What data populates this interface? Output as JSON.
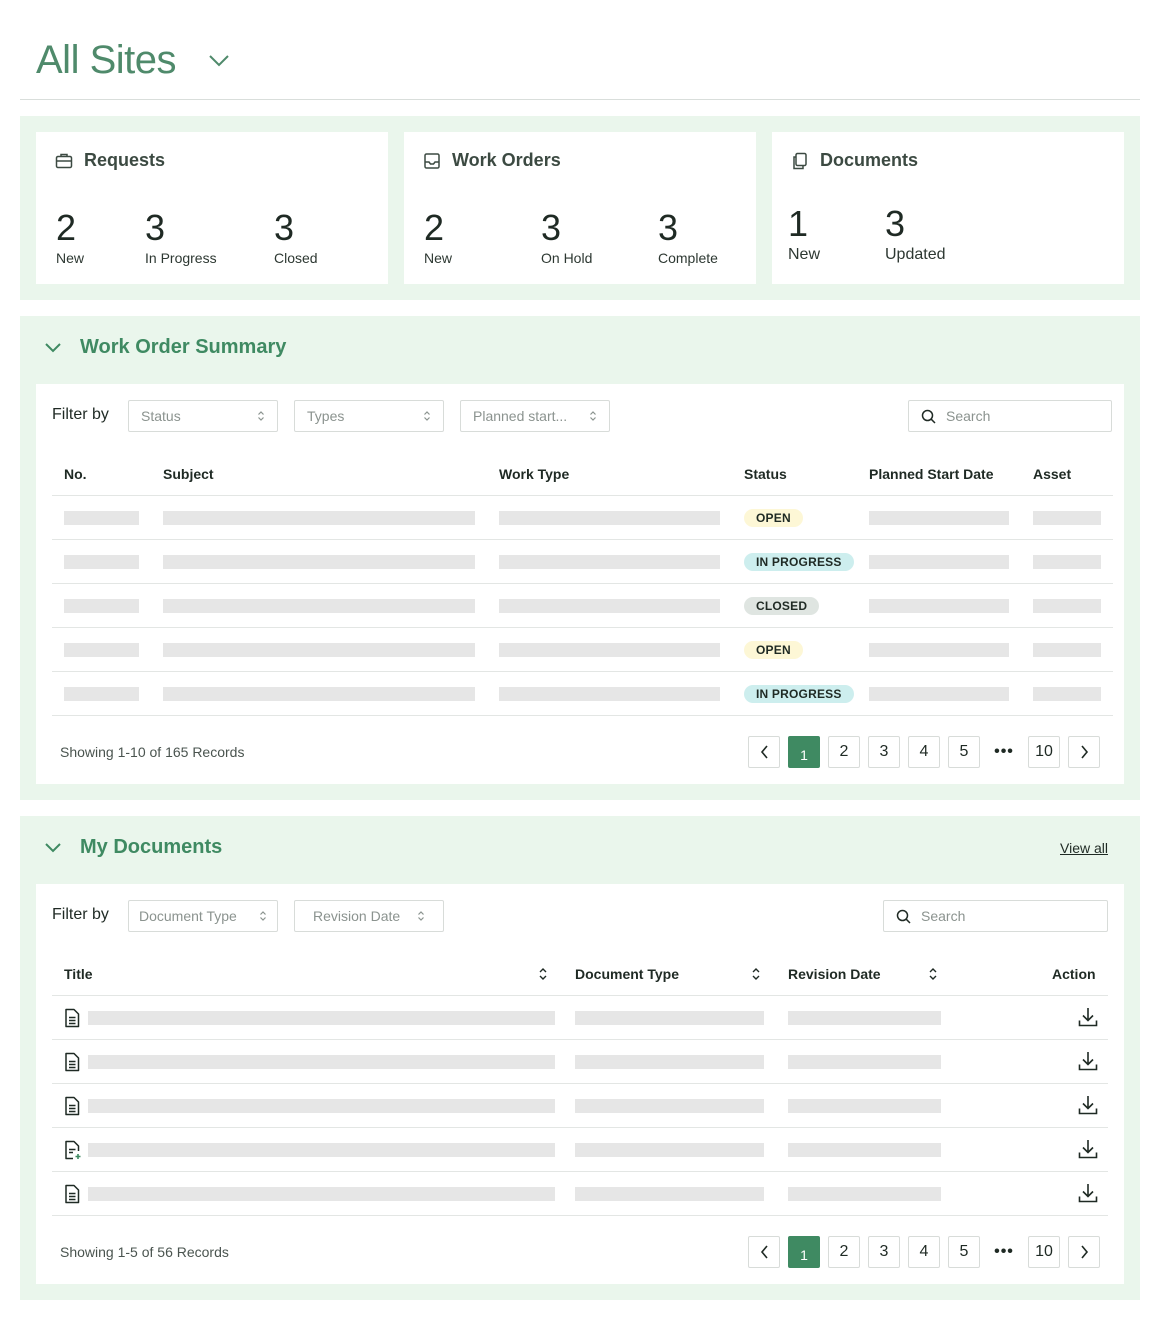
{
  "header": {
    "title": "All Sites"
  },
  "stats": {
    "requests": {
      "title": "Requests",
      "items": [
        {
          "value": "2",
          "label": "New"
        },
        {
          "value": "3",
          "label": "In Progress"
        },
        {
          "value": "3",
          "label": "Closed"
        }
      ]
    },
    "work_orders": {
      "title": "Work Orders",
      "items": [
        {
          "value": "2",
          "label": "New"
        },
        {
          "value": "3",
          "label": "On Hold"
        },
        {
          "value": "3",
          "label": "Complete"
        }
      ]
    },
    "documents": {
      "title": "Documents",
      "items": [
        {
          "value": "1",
          "label": "New"
        },
        {
          "value": "3",
          "label": "Updated"
        }
      ]
    }
  },
  "work_order_summary": {
    "title": "Work Order Summary",
    "filter_label": "Filter by",
    "filters": [
      "Status",
      "Types",
      "Planned start..."
    ],
    "search_placeholder": "Search",
    "columns": [
      "No.",
      "Subject",
      "Work Type",
      "Status",
      "Planned Start Date",
      "Asset"
    ],
    "rows": [
      {
        "status": "OPEN",
        "status_kind": "open"
      },
      {
        "status": "IN PROGRESS",
        "status_kind": "progress"
      },
      {
        "status": "CLOSED",
        "status_kind": "closed"
      },
      {
        "status": "OPEN",
        "status_kind": "open"
      },
      {
        "status": "IN PROGRESS",
        "status_kind": "progress"
      }
    ],
    "records_text": "Showing 1-10 of 165 Records",
    "pagination": {
      "pages": [
        "1",
        "2",
        "3",
        "4",
        "5"
      ],
      "ellipsis": "•••",
      "last": "10",
      "current": "1"
    }
  },
  "my_documents": {
    "title": "My Documents",
    "view_all": "View all",
    "filter_label": "Filter by",
    "filters": [
      "Document Type",
      "Revision Date"
    ],
    "search_placeholder": "Search",
    "columns": [
      "Title",
      "Document Type",
      "Revision Date",
      "Action"
    ],
    "rows": [
      {
        "icon": "document-icon"
      },
      {
        "icon": "document-icon"
      },
      {
        "icon": "document-icon"
      },
      {
        "icon": "document-new-icon"
      },
      {
        "icon": "document-icon"
      }
    ],
    "records_text": "Showing 1-5 of 56 Records",
    "pagination": {
      "pages": [
        "1",
        "2",
        "3",
        "4",
        "5"
      ],
      "ellipsis": "•••",
      "last": "10",
      "current": "1"
    }
  },
  "colors": {
    "accent": "#3f8a62",
    "panel_bg": "#eaf6ec",
    "badge_open": "#fdf7d6",
    "badge_in_progress": "#cdeeee",
    "badge_closed": "#dfe5e1",
    "skeleton": "#e6e6e6"
  }
}
